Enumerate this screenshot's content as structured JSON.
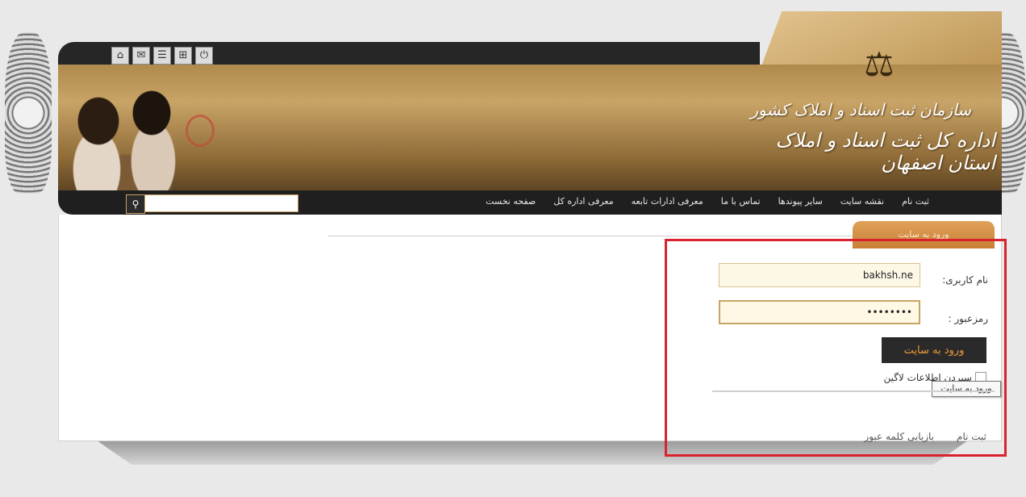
{
  "header": {
    "org_line1": "سازمان ثبت اسناد و املاک کشور",
    "org_line2": "اداره کل ثبت اسناد و املاک استان اصفهان",
    "topbar_icons": [
      "home-icon",
      "mail-icon",
      "rss-icon",
      "sitemap-icon",
      "power-icon"
    ]
  },
  "menu": {
    "items": [
      "صفحه نخست",
      "معرفی اداره کل",
      "معرفی ادارات تابعه",
      "تماس با ما",
      "سایر پیوندها",
      "نقشه سایت",
      "ثبت نام"
    ],
    "search_placeholder": ""
  },
  "login": {
    "tab_title": "ورود به سایت",
    "username_label": "نام کاربری:",
    "username_value": "bakhsh.ne",
    "password_label": "رمزعبور :",
    "password_value": "••••••••",
    "submit_label": "ورود به سایت",
    "remember_label": "سپردن اطلاعات لاگین",
    "tooltip": "ورود به سایت",
    "register_link": "ثبت نام",
    "recover_link": "بازیابی کلمه عبور"
  },
  "colors": {
    "accent_gold": "#c9a467",
    "menu_bg": "#1f1f1f",
    "button_text": "#f09a3b",
    "highlight_red": "#d9222e"
  }
}
